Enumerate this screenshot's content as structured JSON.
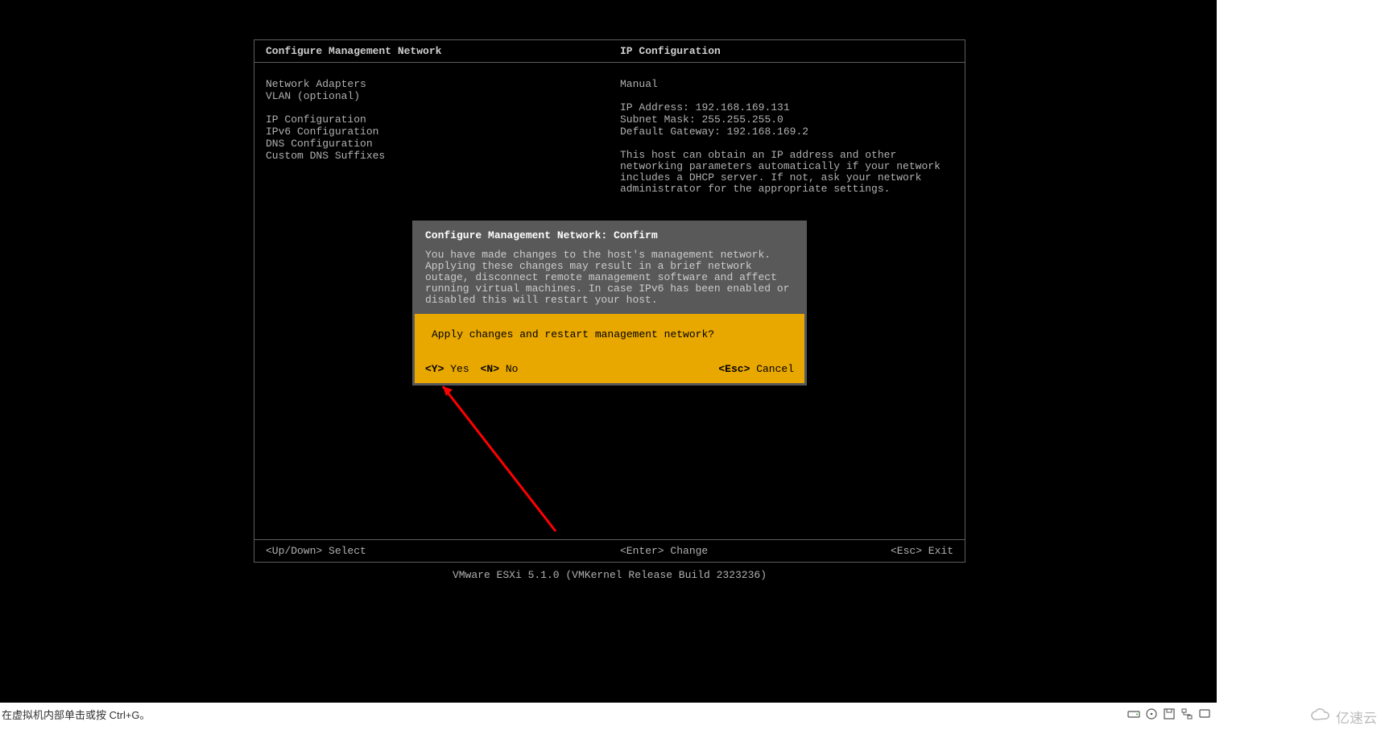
{
  "header": {
    "left_title": "Configure Management Network",
    "right_title": "IP Configuration"
  },
  "menu": {
    "items": [
      "Network Adapters",
      "VLAN (optional)",
      "",
      "IP Configuration",
      "IPv6 Configuration",
      "DNS Configuration",
      "Custom DNS Suffixes"
    ]
  },
  "info": {
    "mode": "Manual",
    "ip_label": "IP Address:",
    "ip_value": "192.168.169.131",
    "mask_label": "Subnet Mask:",
    "mask_value": "255.255.255.0",
    "gw_label": "Default Gateway:",
    "gw_value": "192.168.169.2",
    "paragraph": "This host can obtain an IP address and other networking parameters automatically if your network includes a DHCP server. If not, ask your network administrator for the appropriate settings."
  },
  "dialog": {
    "title": "Configure Management Network: Confirm",
    "body": "You have made changes to the host's management network. Applying these changes may result in a brief network outage, disconnect remote management software and affect running virtual machines. In case IPv6 has been enabled or disabled this will restart your host.",
    "question": "Apply changes and restart management network?",
    "yes_key": "<Y>",
    "yes_label": "Yes",
    "no_key": "<N>",
    "no_label": "No",
    "cancel_key": "<Esc>",
    "cancel_label": "Cancel"
  },
  "footer": {
    "updown": "<Up/Down> Select",
    "enter": "<Enter> Change",
    "esc": "<Esc> Exit"
  },
  "product": "VMware ESXi 5.1.0 (VMKernel Release Build 2323236)",
  "vm": {
    "hint": "在虚拟机内部单击或按 Ctrl+G。"
  },
  "watermark": "亿速云"
}
